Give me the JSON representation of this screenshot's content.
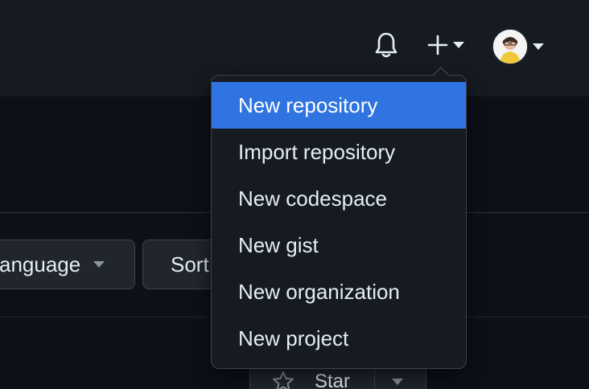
{
  "header": {
    "icons": {
      "bell": "bell-icon",
      "plus": "plus-icon",
      "avatar": "avatar"
    }
  },
  "filters": {
    "language_label": "anguage",
    "sort_label": "Sort"
  },
  "repo_actions": {
    "star_label": "Star"
  },
  "create_menu": {
    "items": [
      {
        "label": "New repository",
        "active": true
      },
      {
        "label": "Import repository",
        "active": false
      },
      {
        "label": "New codespace",
        "active": false
      },
      {
        "label": "New gist",
        "active": false
      },
      {
        "label": "New organization",
        "active": false
      },
      {
        "label": "New project",
        "active": false
      }
    ]
  },
  "colors": {
    "background": "#0d1117",
    "header": "#161b22",
    "menu_active": "#2f74e0",
    "text": "#e6edf3"
  }
}
